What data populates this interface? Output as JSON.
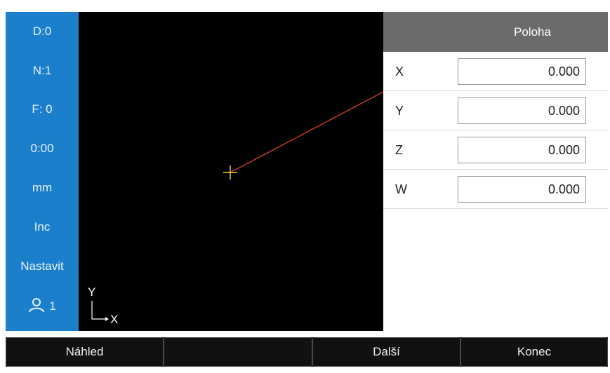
{
  "sidebar": {
    "items": [
      {
        "label": "D:0"
      },
      {
        "label": "N:1"
      },
      {
        "label": "F:  0"
      },
      {
        "label": "0:00"
      },
      {
        "label": "mm"
      },
      {
        "label": "Inc"
      },
      {
        "label": "Nastavit"
      }
    ],
    "user": {
      "icon": "user-icon",
      "label": "1"
    }
  },
  "canvas": {
    "axis_indicator": {
      "y_label": "Y",
      "x_label": "X"
    },
    "colors": {
      "crosshair": "#e8d23a",
      "toolpath": "#c0392b"
    }
  },
  "panel": {
    "title": "Poloha",
    "rows": [
      {
        "axis": "X",
        "value": "0.000"
      },
      {
        "axis": "Y",
        "value": "0.000"
      },
      {
        "axis": "Z",
        "value": "0.000"
      },
      {
        "axis": "W",
        "value": "0.000"
      }
    ]
  },
  "softkeys": [
    {
      "label": "Náhled"
    },
    {
      "label": ""
    },
    {
      "label": "Další"
    },
    {
      "label": "Konec"
    }
  ],
  "colors": {
    "sidebar_bg": "#1b7fcc",
    "panel_header_bg": "#6b6b6b",
    "softkey_bg": "#111111"
  }
}
